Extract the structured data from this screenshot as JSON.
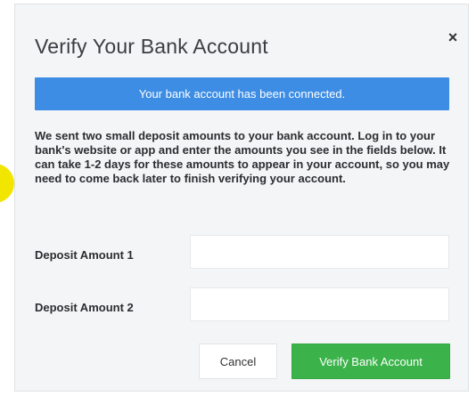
{
  "modal": {
    "title": "Verify Your Bank Account",
    "close_glyph": "×",
    "banner": "Your bank account has been connected.",
    "description": "We sent two small deposit amounts to your bank account. Log in to your bank's website or app and enter the amounts you see in the fields below. It can take 1-2 days for these amounts to appear in your account, so you may need to come back later to finish verifying your account.",
    "fields": [
      {
        "label": "Deposit Amount 1",
        "value": "",
        "placeholder": ""
      },
      {
        "label": "Deposit Amount 2",
        "value": "",
        "placeholder": ""
      }
    ],
    "buttons": {
      "cancel": "Cancel",
      "verify": "Verify Bank Account"
    }
  },
  "colors": {
    "banner": "#3d8de4",
    "verify_button": "#3bb34a",
    "modal_background": "#f4f5f6",
    "accent_shape": "#f2e600"
  },
  "icons": {
    "close": "close-icon"
  }
}
